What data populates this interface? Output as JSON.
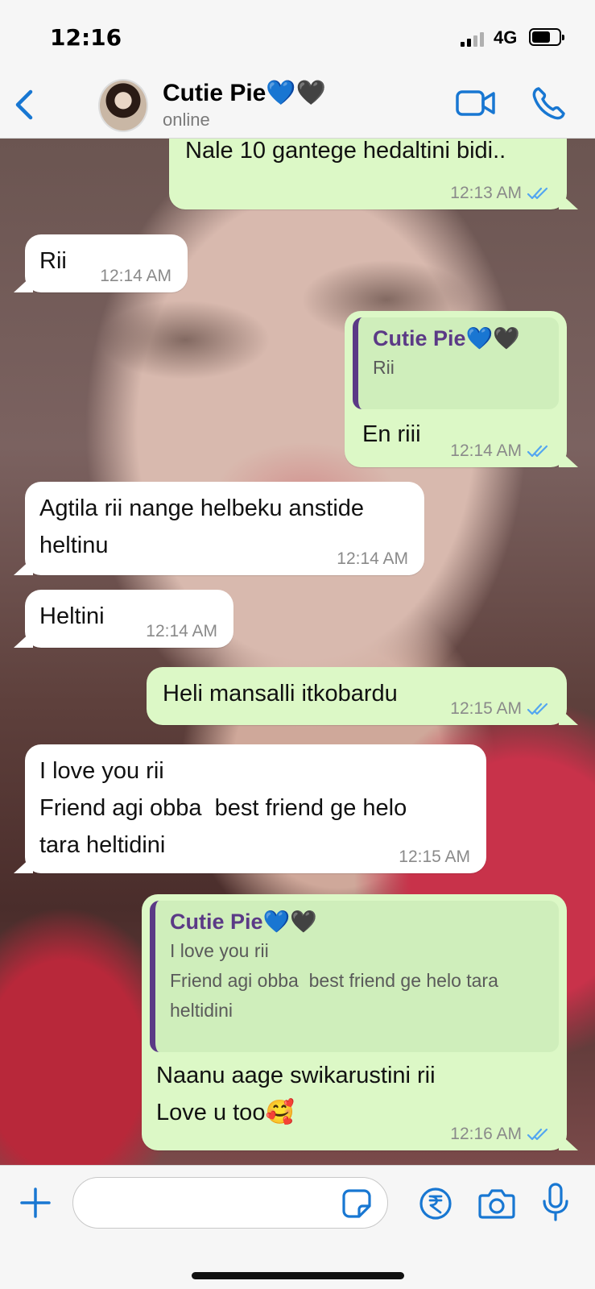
{
  "status_bar": {
    "time": "12:16",
    "network": "4G"
  },
  "header": {
    "contact_name": "Cutie Pie💙🖤",
    "status": "online"
  },
  "messages": [
    {
      "direction": "outgoing",
      "text": "Nale 10 gantege hedaltini bidi..",
      "time": "12:13 AM",
      "read": true
    },
    {
      "direction": "incoming",
      "text": "Rii",
      "time": "12:14 AM"
    },
    {
      "direction": "outgoing",
      "quoted_name": "Cutie Pie💙🖤",
      "quoted_text": "Rii",
      "text": "En riii",
      "time": "12:14 AM",
      "read": true
    },
    {
      "direction": "incoming",
      "text": "Agtila rii nange helbeku anstide\nheltinu",
      "time": "12:14 AM"
    },
    {
      "direction": "incoming",
      "text": "Heltini",
      "time": "12:14 AM"
    },
    {
      "direction": "outgoing",
      "text": "Heli mansalli itkobardu",
      "time": "12:15 AM",
      "read": true
    },
    {
      "direction": "incoming",
      "text": "I love you rii\nFriend agi obba  best friend ge helo\ntara heltidini",
      "time": "12:15 AM"
    },
    {
      "direction": "outgoing",
      "quoted_name": "Cutie Pie💙🖤",
      "quoted_text": "I love you rii\nFriend agi obba  best friend ge helo tara\nheltidini",
      "text": "Naanu aage swikarustini rii\nLove u too🥰",
      "time": "12:16 AM",
      "read": true
    }
  ],
  "input": {
    "value": "",
    "placeholder": ""
  },
  "colors": {
    "accent": "#1877d2",
    "outgoing_bubble": "#dcf8c6",
    "incoming_bubble": "#ffffff",
    "read_ticks": "#53a6f0",
    "quote_name": "#5b3a86"
  },
  "icons": [
    "back-icon",
    "video-call-icon",
    "phone-call-icon",
    "plus-icon",
    "sticker-icon",
    "rupee-payment-icon",
    "camera-icon",
    "microphone-icon",
    "read-ticks-icon"
  ]
}
